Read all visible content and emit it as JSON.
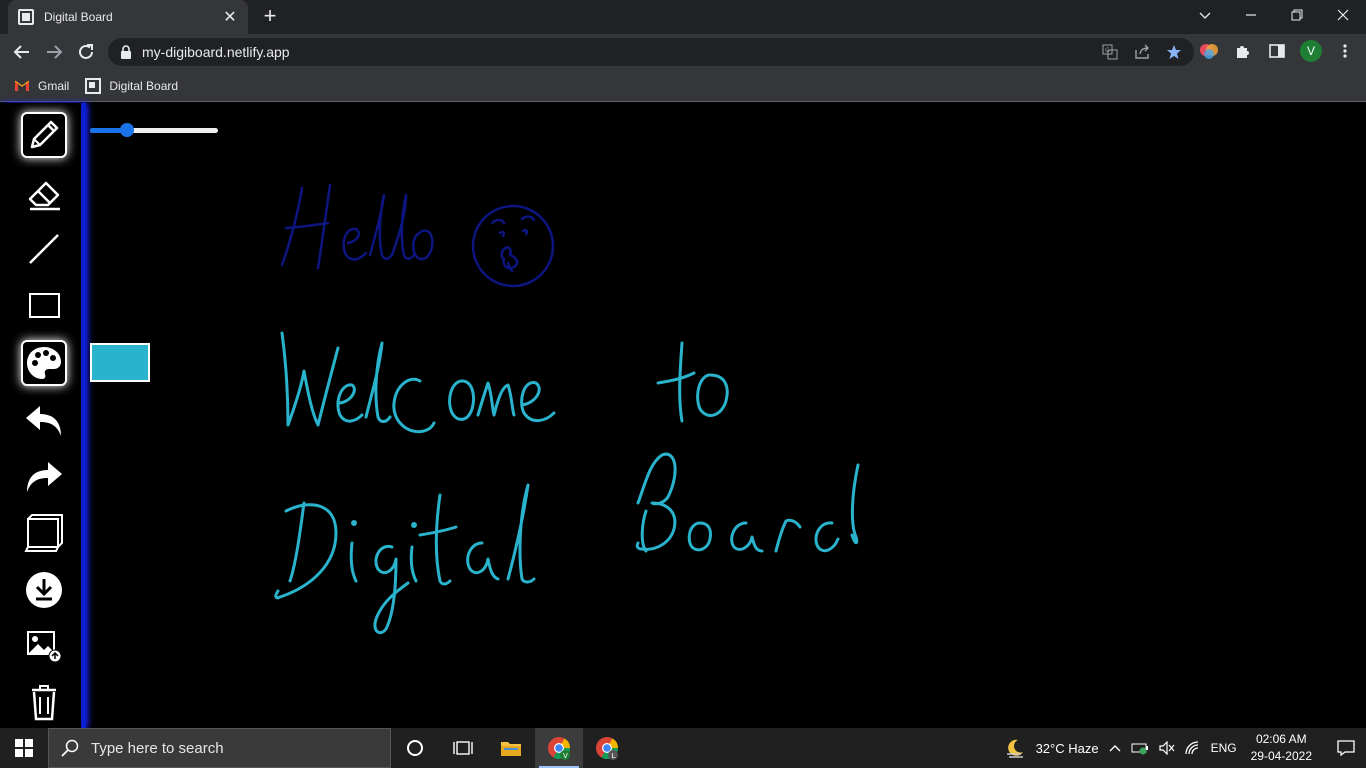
{
  "browser": {
    "tab_title": "Digital Board",
    "url": "my-digiboard.netlify.app",
    "avatar_letter": "V",
    "bookmarks": [
      {
        "label": "Gmail",
        "icon": "gmail-icon"
      },
      {
        "label": "Digital Board",
        "icon": "digital-board-icon"
      }
    ]
  },
  "board": {
    "tools": [
      {
        "name": "pencil-tool",
        "icon": "pencil-icon",
        "active": true
      },
      {
        "name": "eraser-tool",
        "icon": "eraser-icon",
        "active": false
      },
      {
        "name": "line-tool",
        "icon": "line-icon",
        "active": false
      },
      {
        "name": "rectangle-tool",
        "icon": "rectangle-icon",
        "active": false
      },
      {
        "name": "color-tool",
        "icon": "palette-icon",
        "active": true
      },
      {
        "name": "undo-tool",
        "icon": "undo-icon",
        "active": false
      },
      {
        "name": "redo-tool",
        "icon": "redo-icon",
        "active": false
      },
      {
        "name": "notes-tool",
        "icon": "notes-icon",
        "active": false
      },
      {
        "name": "download-tool",
        "icon": "download-icon",
        "active": false
      },
      {
        "name": "upload-image-tool",
        "icon": "image-upload-icon",
        "active": false
      },
      {
        "name": "clear-tool",
        "icon": "trash-icon",
        "active": false
      }
    ],
    "brush_size_fraction": 0.26,
    "selected_color": "#2ab3cc",
    "drawing_colors": {
      "hello": "#0d1680",
      "welcome": "#2ab3cc"
    },
    "handwritten_text": {
      "line1": "Hello",
      "line2": "Welcome to",
      "line3": "Digital Board"
    }
  },
  "taskbar": {
    "search_placeholder": "Type here to search",
    "weather": "32°C  Haze",
    "language": "ENG",
    "time": "02:06 AM",
    "date": "29-04-2022"
  }
}
